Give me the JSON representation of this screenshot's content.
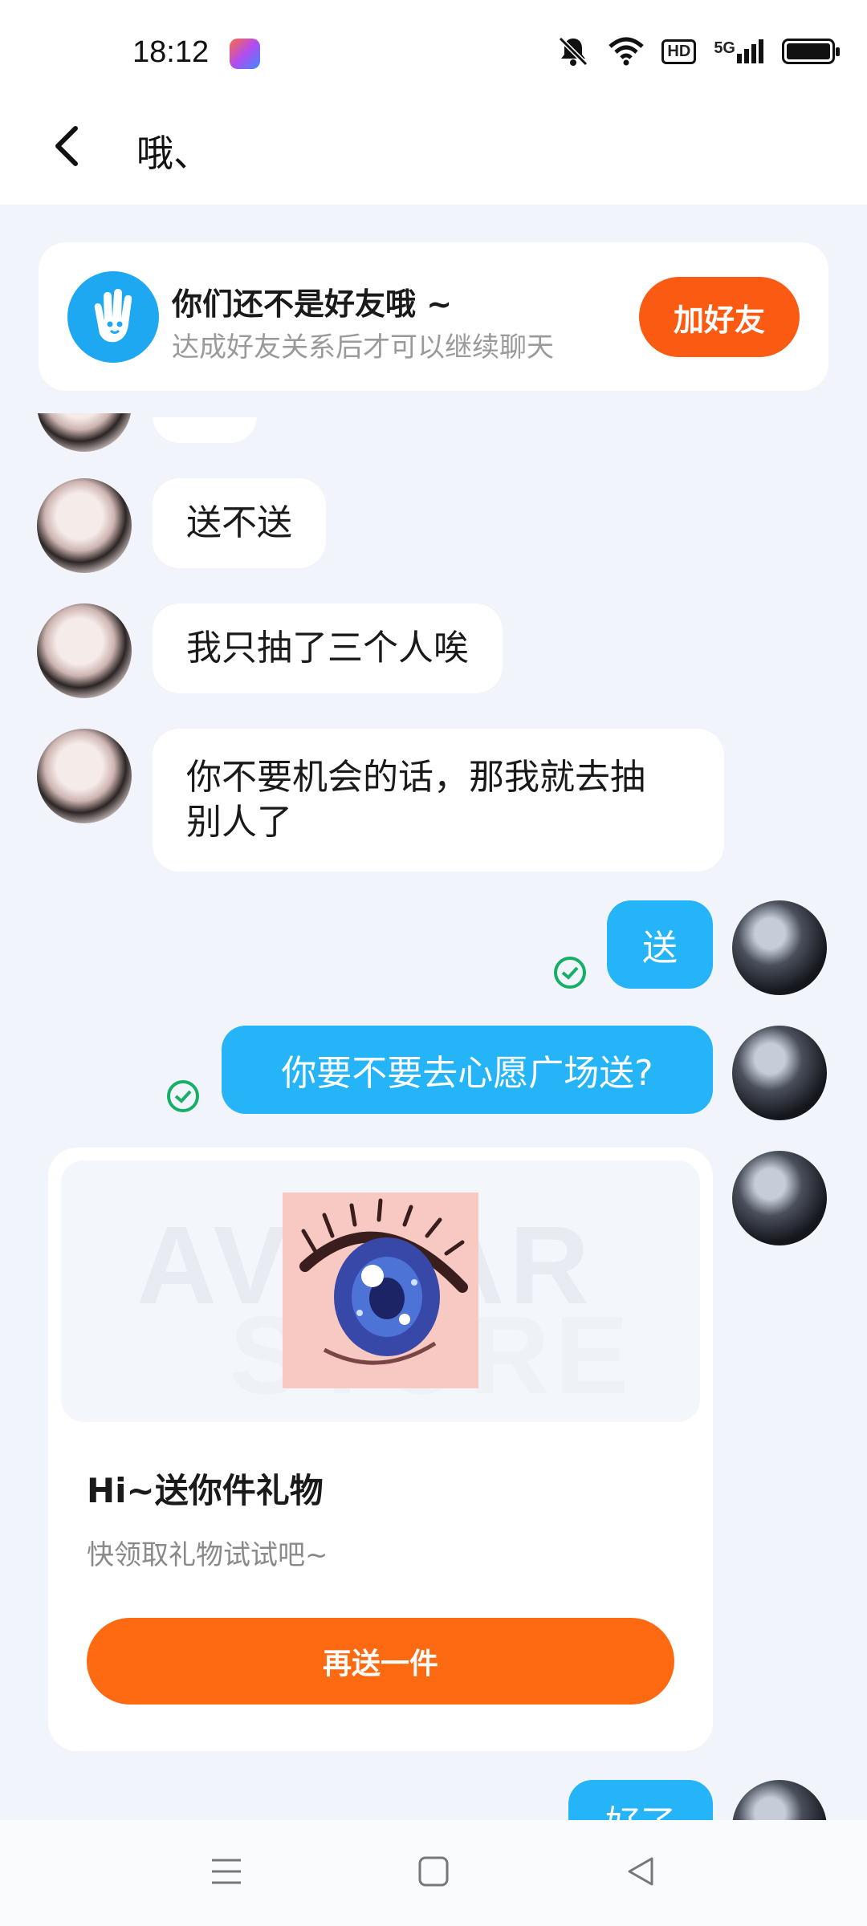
{
  "status_bar": {
    "time": "18:12",
    "hd": "HD",
    "network": "5G"
  },
  "header": {
    "title": "哦、"
  },
  "banner": {
    "title": "你们还不是好友哦 ~",
    "subtitle": "达成好友关系后才可以继续聊天",
    "add_friend_label": "加好友"
  },
  "messages": [
    {
      "direction": "in",
      "text": "送不送"
    },
    {
      "direction": "in",
      "text": "我只抽了三个人唉"
    },
    {
      "direction": "in",
      "text_line1": "你不要机会的话，那我就去抽",
      "text_line2": "别人了"
    },
    {
      "direction": "out",
      "text": "送",
      "read": true
    },
    {
      "direction": "out",
      "text": "你要不要去心愿广场送?",
      "read": true
    },
    {
      "direction": "out",
      "text": "好了"
    }
  ],
  "gift_card": {
    "watermark_line1": "AVATAR",
    "watermark_line2": "STORE",
    "title": "Hi~送你件礼物",
    "subtitle": "快领取礼物试试吧~",
    "button_label": "再送一件"
  },
  "icons": {
    "back": "back-arrow-icon",
    "hand": "hand-wave-icon",
    "read": "read-check-icon",
    "menu": "menu-icon",
    "home": "home-icon",
    "back_nav": "back-triangle-icon"
  },
  "colors": {
    "accent_orange": "#fa5a12",
    "bubble_blue": "#24b4f7",
    "read_green": "#15b066",
    "background": "#f1f5fb"
  }
}
